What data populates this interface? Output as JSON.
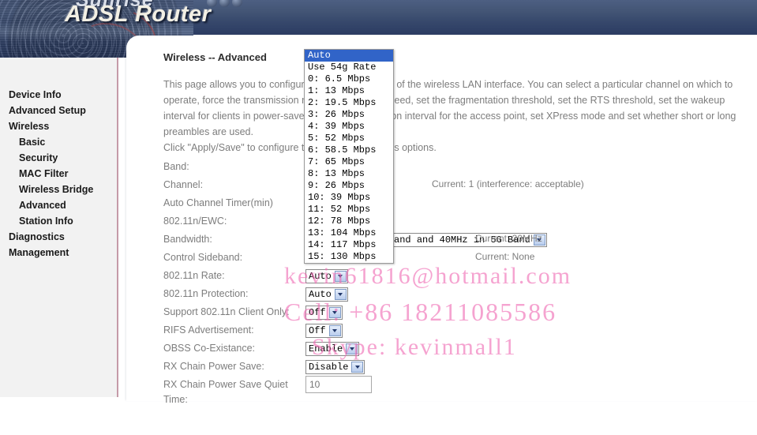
{
  "banner": {
    "brand": "Sunrise",
    "title": "ADSL Router"
  },
  "sidebar": {
    "items": [
      {
        "label": "Device Info",
        "sub": false
      },
      {
        "label": "Advanced Setup",
        "sub": false
      },
      {
        "label": "Wireless",
        "sub": false
      },
      {
        "label": "Basic",
        "sub": true
      },
      {
        "label": "Security",
        "sub": true
      },
      {
        "label": "MAC Filter",
        "sub": true
      },
      {
        "label": "Wireless Bridge",
        "sub": true
      },
      {
        "label": "Advanced",
        "sub": true
      },
      {
        "label": "Station Info",
        "sub": true
      },
      {
        "label": "Diagnostics",
        "sub": false
      },
      {
        "label": "Management",
        "sub": false
      }
    ]
  },
  "page": {
    "heading": "Wireless -- Advanced",
    "intro_lines": [
      "This page allows you to configure advanced features of the wireless LAN interface. You can select a particular channel on which to",
      "operate, force the transmission rate to a particular speed, set the fragmentation threshold, set the RTS threshold, set the wakeup",
      "interval for clients in power-save mode, set the beacon interval for the access point, set XPress mode and set whether short or long",
      "preambles are used.",
      "Click \"Apply/Save\" to configure the advanced wireless options."
    ]
  },
  "form": {
    "rows": [
      {
        "label": "Band:",
        "control": "none",
        "value": "",
        "current": ""
      },
      {
        "label": "Channel:",
        "control": "none",
        "value": "",
        "current": "Current: 1 (interference: acceptable)"
      },
      {
        "label": "Auto Channel Timer(min)",
        "control": "none",
        "value": "",
        "current": ""
      },
      {
        "label": "802.11n/EWC:",
        "control": "none",
        "value": "",
        "current": ""
      },
      {
        "label": "Bandwidth:",
        "control": "select",
        "value": "20MHz in 2.4G Band and 40MHz in 5G Band",
        "current": "Current: 20MHz"
      },
      {
        "label": "Control Sideband:",
        "control": "none",
        "value": "",
        "current": "Current: None"
      },
      {
        "label": "802.11n Rate:",
        "control": "select",
        "value": "Auto",
        "current": ""
      },
      {
        "label": "802.11n Protection:",
        "control": "select",
        "value": "Auto",
        "current": ""
      },
      {
        "label": "Support 802.11n Client Only:",
        "control": "select",
        "value": "Off",
        "current": ""
      },
      {
        "label": "RIFS Advertisement:",
        "control": "select",
        "value": "Off",
        "current": ""
      },
      {
        "label": "OBSS Co-Existance:",
        "control": "select",
        "value": "Enable",
        "current": ""
      },
      {
        "label": "RX Chain Power Save:",
        "control": "select",
        "value": "Disable",
        "current": ""
      },
      {
        "label": "RX Chain Power Save Quiet Time:",
        "control": "text",
        "value": "10",
        "current": ""
      }
    ]
  },
  "dropdown": {
    "name": "802.11n Rate",
    "selected": "Auto",
    "options": [
      "Auto",
      "Use 54g Rate",
      "0: 6.5 Mbps",
      "1: 13 Mbps",
      "2: 19.5 Mbps",
      "3: 26 Mbps",
      "4: 39 Mbps",
      "5: 52 Mbps",
      "6: 58.5 Mbps",
      "7: 65 Mbps",
      "8: 13 Mbps",
      "9: 26 Mbps",
      "10: 39 Mbps",
      "11: 52 Mbps",
      "12: 78 Mbps",
      "13: 104 Mbps",
      "14: 117 Mbps",
      "15: 130 Mbps"
    ]
  },
  "watermark": {
    "email": "kevin61816@hotmail.com",
    "cell": "Cell: +86 18211085586",
    "skype": "Skype: kevinmall1",
    "color": "#f06bb4"
  }
}
